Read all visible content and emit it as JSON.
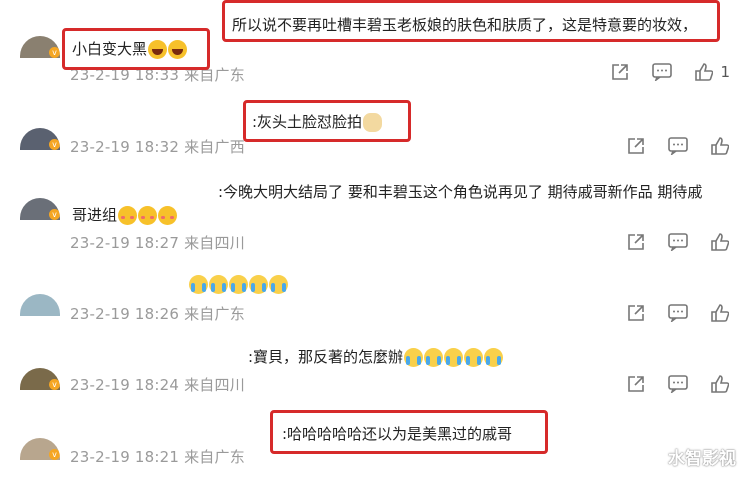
{
  "comments": [
    {
      "reply_text": "所以说不要再吐槽丰碧玉老板娘的肤色和肤质了，这是特意要的妆效，",
      "text": "小白变大黑",
      "emojis": [
        "laugh",
        "laugh"
      ],
      "meta": "23-2-19 18:33 来自广东",
      "likes": "1",
      "avatar_color": "#8a8070"
    },
    {
      "text": ":灰头土脸怼脸拍",
      "emojis": [
        "dog"
      ],
      "meta": "23-2-19 18:32 来自广西",
      "avatar_color": "#5a6170"
    },
    {
      "text": ":今晚大明大结局了 要和丰碧玉这个角色说再见了 期待戚哥新作品 期待戚",
      "text_line2": "哥进组",
      "emojis": [
        "blush",
        "blush",
        "blush"
      ],
      "meta": "23-2-19 18:27 来自四川",
      "avatar_color": "#6a6f78"
    },
    {
      "text": "",
      "emojis": [
        "cry",
        "cry",
        "cry",
        "cry",
        "cry"
      ],
      "meta": "23-2-19 18:26 来自广东",
      "avatar_color": "#9bb7c4"
    },
    {
      "text": ":寶貝，那反著的怎麼辦",
      "emojis": [
        "cry",
        "cry",
        "cry",
        "cry",
        "cry"
      ],
      "meta": "23-2-19 18:24 来自四川",
      "avatar_color": "#7a6a4a"
    },
    {
      "text": ":哈哈哈哈哈还以为是美黑过的戚哥",
      "emojis": [],
      "meta": "23-2-19 18:21 来自广东",
      "avatar_color": "#b8a68e"
    }
  ],
  "icons": {
    "share": "share-icon",
    "comment": "comment-icon",
    "like": "like-icon"
  },
  "watermark": "水智影视"
}
